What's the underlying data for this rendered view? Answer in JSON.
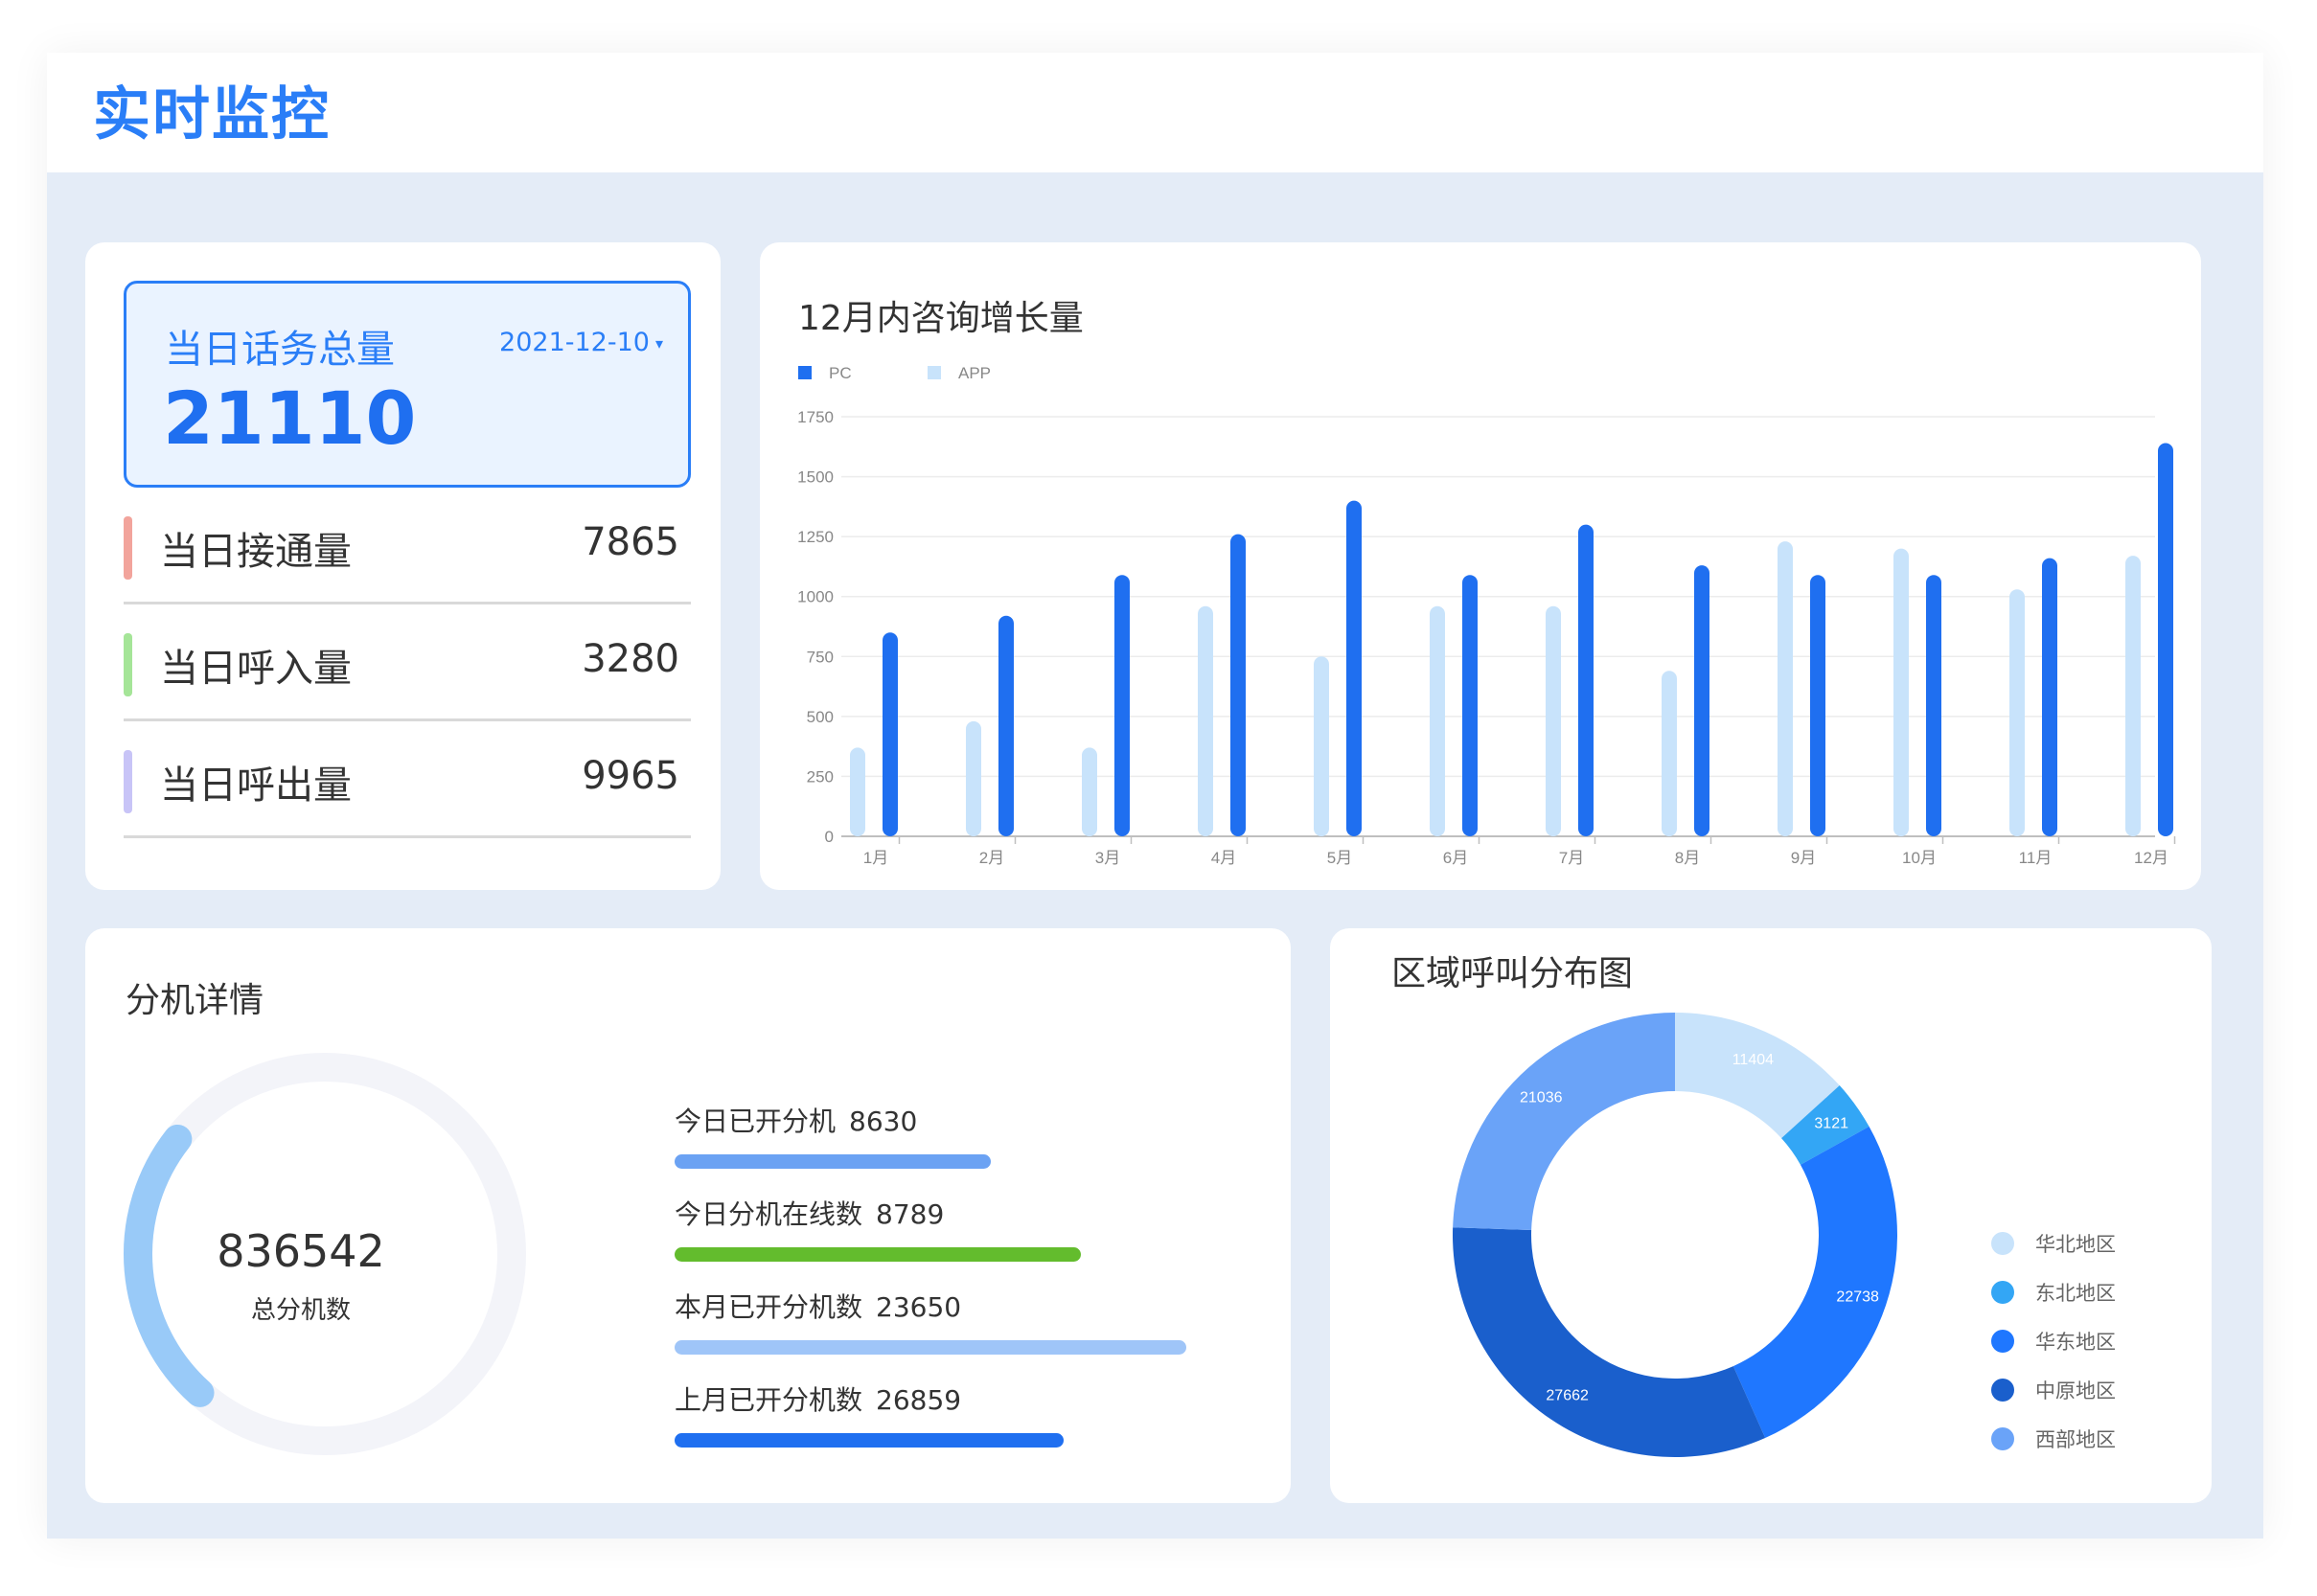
{
  "page": {
    "title": "实时监控"
  },
  "summary": {
    "total_label": "当日话务总量",
    "date": "2021-12-10",
    "total_value": "21110",
    "stats": [
      {
        "label": "当日接通量",
        "value": "7865",
        "color": "#f2a49c"
      },
      {
        "label": "当日呼入量",
        "value": "3280",
        "color": "#a5e598"
      },
      {
        "label": "当日呼出量",
        "value": "9965",
        "color": "#c8c4f7"
      }
    ]
  },
  "chart_data": {
    "type": "bar",
    "title": "12月内咨询增长量",
    "categories": [
      "1月",
      "2月",
      "3月",
      "4月",
      "5月",
      "6月",
      "7月",
      "8月",
      "9月",
      "10月",
      "11月",
      "12月"
    ],
    "series": [
      {
        "name": "PC",
        "color": "#1f6ff0",
        "values": [
          850,
          920,
          1090,
          1260,
          1400,
          1090,
          1300,
          1130,
          1090,
          1090,
          1160,
          1640
        ]
      },
      {
        "name": "APP",
        "color": "#c8e3fb",
        "values": [
          370,
          480,
          370,
          960,
          750,
          960,
          960,
          690,
          1230,
          1200,
          1030,
          1170
        ]
      }
    ],
    "yticks": [
      0,
      250,
      500,
      750,
      1000,
      1250,
      1500,
      1750
    ],
    "ylim": [
      0,
      1750
    ],
    "legend": "top-left",
    "grid": true
  },
  "extensions": {
    "title": "分机详情",
    "total_value": "836542",
    "total_label": "总分机数",
    "gauge_colors": {
      "track": "#f3f4f9",
      "fill": "#99caf8"
    },
    "items": [
      {
        "label": "今日已开分机",
        "value": "8630",
        "color": "#6ba2f3"
      },
      {
        "label": "今日分机在线数",
        "value": "8789",
        "color": "#63bc2d"
      },
      {
        "label": "本月已开分机数",
        "value": "23650",
        "color": "#9fc5f8"
      },
      {
        "label": "上月已开分机数",
        "value": "26859",
        "color": "#1f6ff0"
      }
    ]
  },
  "region": {
    "title": "区域呼叫分布图",
    "slices": [
      {
        "name": "华北地区",
        "value": 11404,
        "color": "#c8e3fb",
        "label_color": "#ffffff"
      },
      {
        "name": "东北地区",
        "value": 3121,
        "color": "#33a6f5",
        "label_color": "#ffffff"
      },
      {
        "name": "华东地区",
        "value": 22738,
        "color": "#1f77ff",
        "label_color": "#ffffff"
      },
      {
        "name": "中原地区",
        "value": 27662,
        "color": "#1a5fcc",
        "label_color": "#ffffff"
      },
      {
        "name": "西部地区",
        "value": 21036,
        "color": "#6aa3f8",
        "label_color": "#ffffff"
      }
    ]
  }
}
